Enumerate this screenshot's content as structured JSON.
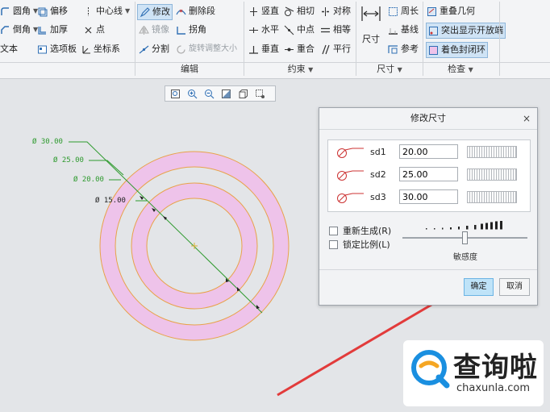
{
  "ribbon": {
    "col1": [
      {
        "label": "圆角",
        "icon": "fillet-icon"
      },
      {
        "label": "倒角",
        "icon": "chamfer-icon"
      },
      {
        "label": "文本",
        "icon": "text-icon"
      }
    ],
    "col2": [
      {
        "label": "偏移",
        "icon": "offset-icon"
      },
      {
        "label": "加厚",
        "icon": "thicken-icon"
      },
      {
        "label": "选项板",
        "icon": "palette-icon"
      }
    ],
    "col3": [
      {
        "label": "中心线",
        "icon": "centerline-icon"
      },
      {
        "label": "点",
        "icon": "point-icon"
      },
      {
        "label": "坐标系",
        "icon": "coordinate-system-icon"
      }
    ],
    "edit": {
      "modify": "修改",
      "delete_segment": "删除段",
      "mirror": "镜像",
      "corner": "拐角",
      "divide": "分割",
      "rotate_resize": "旋转调整大小",
      "label": "编辑"
    },
    "constraints": {
      "vertical": "竖直",
      "tangent": "相切",
      "symmetric": "对称",
      "horizontal": "水平",
      "midpoint": "中点",
      "equal": "相等",
      "perpendicular": "垂直",
      "coincident": "重合",
      "parallel": "平行",
      "label": "约束"
    },
    "dimension": {
      "dimension_btn": "尺寸",
      "perimeter": "周长",
      "baseline": "基线",
      "reference": "参考",
      "label": "尺寸"
    },
    "inspect": {
      "overlap": "重叠几何",
      "highlight_open": "突出显示开放端",
      "shade_closed": "着色封闭环",
      "label": "检查"
    }
  },
  "canvas": {
    "dims": [
      {
        "text": "Ø 30.00",
        "tone": "green"
      },
      {
        "text": "Ø 25.00",
        "tone": "green"
      },
      {
        "text": "Ø 20.00",
        "tone": "green"
      },
      {
        "text": "Ø 15.00",
        "tone": "dark"
      }
    ]
  },
  "dialog": {
    "title": "修改尺寸",
    "close": "×",
    "rows": [
      {
        "name": "sd1",
        "value": "20.00"
      },
      {
        "name": "sd2",
        "value": "25.00"
      },
      {
        "name": "sd3",
        "value": "30.00"
      }
    ],
    "regenerate": "重新生成(R)",
    "lock_scale": "锁定比例(L)",
    "sensitivity": "敏感度",
    "ok": "确定",
    "cancel": "取消"
  },
  "watermark": {
    "name": "查询啦",
    "url": "chaxunla.com"
  },
  "colors": {
    "ring_fill": "#eec3ea",
    "ring_stroke": "#e8a24a",
    "dim_green": "#2e9a2e",
    "arrow_red": "#e23b3b",
    "ok_highlight": "#bfe3f8"
  }
}
